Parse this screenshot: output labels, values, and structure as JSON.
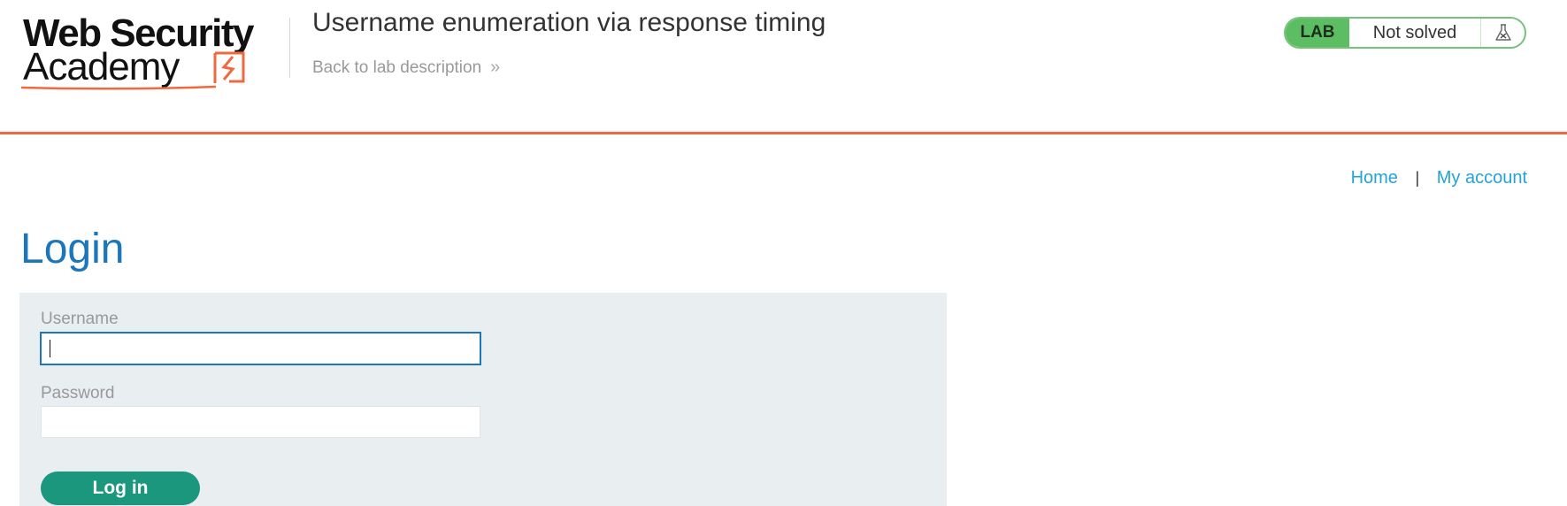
{
  "logo": {
    "line1": "Web Security",
    "line2": "Academy",
    "mark_icon": "lightning-bolt-icon",
    "brand_color": "#f0693e"
  },
  "header": {
    "lab_title": "Username enumeration via response timing",
    "back_link": "Back to lab description",
    "back_icon": "double-chevron-right-icon"
  },
  "status": {
    "label": "LAB",
    "text": "Not solved",
    "icon": "flask-icon",
    "color": "#5cbd62"
  },
  "nav": {
    "home": "Home",
    "separator": "|",
    "account": "My account",
    "link_color": "#23a3d8"
  },
  "login": {
    "heading": "Login",
    "username_label": "Username",
    "username_value": "",
    "password_label": "Password",
    "password_value": "",
    "button_label": "Log in",
    "button_color": "#1b977d",
    "heading_color": "#1b76bc"
  }
}
